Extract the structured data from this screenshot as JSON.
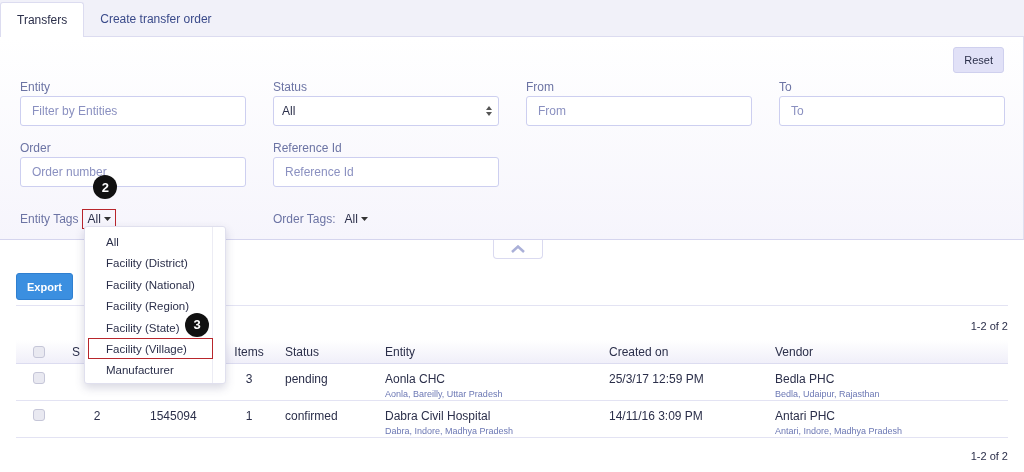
{
  "tabs": [
    {
      "label": "Transfers",
      "selected": true
    },
    {
      "label": "Create transfer order",
      "selected": false
    }
  ],
  "filters": {
    "reset": "Reset",
    "fields": [
      {
        "label": "Entity",
        "kind": "text",
        "placeholder": "Filter by Entities"
      },
      {
        "label": "Status",
        "kind": "select",
        "value": "All"
      },
      {
        "label": "From",
        "kind": "text",
        "placeholder": "From"
      },
      {
        "label": "To",
        "kind": "text",
        "placeholder": "To"
      },
      {
        "label": "Order",
        "kind": "text",
        "placeholder": "Order number"
      },
      {
        "label": "Reference Id",
        "kind": "text",
        "placeholder": "Reference Id"
      }
    ],
    "tags": [
      {
        "label": "Entity Tags",
        "value": "All",
        "callout": "2",
        "boxed": true
      },
      {
        "label": "Order Tags:",
        "value": "All",
        "boxed": false
      }
    ]
  },
  "export": "Export",
  "pagination_top": "1-2 of 2",
  "table": {
    "select_all_checked": false,
    "columns": {
      "s": "S",
      "items": "Items",
      "status": "Status",
      "entity": "Entity",
      "created_on": "Created on",
      "vendor": "Vendor"
    },
    "rows": [
      {
        "checked": false,
        "items": "3",
        "status": "pending",
        "entity": "Aonla CHC",
        "entity_location": "Aonla, Bareilly, Uttar Pradesh",
        "created_on": "25/3/17 12:59 PM",
        "vendor": "Bedla PHC",
        "vendor_location": "Bedla, Udaipur, Rajasthan"
      },
      {
        "checked": false,
        "s": "2",
        "order": "1545094",
        "items": "1",
        "status": "confirmed",
        "entity": "Dabra Civil Hospital",
        "entity_location": "Dabra, Indore, Madhya Pradesh",
        "created_on": "14/11/16 3:09 PM",
        "vendor": "Antari PHC",
        "vendor_location": "Antari, Indore, Madhya Pradesh"
      }
    ]
  },
  "pagination_bottom": "1-2 of 2",
  "tag_menu": {
    "items": [
      {
        "label": "All",
        "boxed": false
      },
      {
        "label": "Facility (District)",
        "boxed": false
      },
      {
        "label": "Facility (National)",
        "boxed": false
      },
      {
        "label": "Facility (Region)",
        "boxed": false
      },
      {
        "label": "Facility (State)",
        "boxed": false
      },
      {
        "label": "Facility (Village)",
        "boxed": true,
        "callout": "3"
      },
      {
        "label": "Manufacturer",
        "boxed": false
      }
    ]
  }
}
